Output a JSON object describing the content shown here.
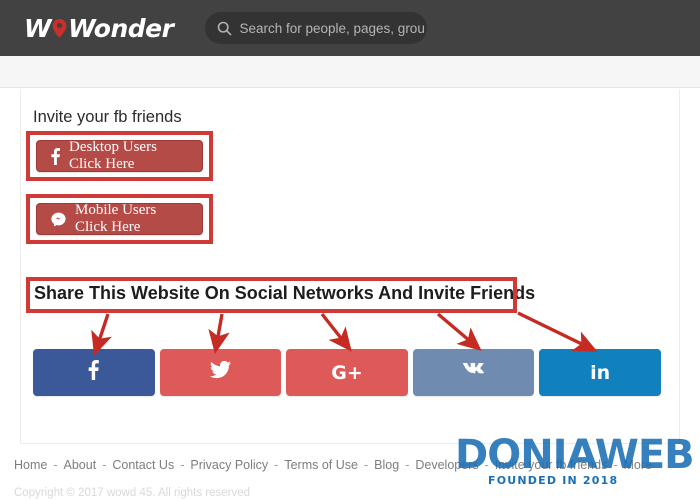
{
  "header": {
    "logo_prefix": "W",
    "logo_pin_icon": "location-pin-icon",
    "logo_suffix": "Wonder",
    "search": {
      "icon": "search-icon",
      "placeholder": "Search for people, pages, groups",
      "value": ""
    }
  },
  "main": {
    "invite_title": "Invite your fb friends",
    "desktop_button": {
      "icon": "facebook-f-icon",
      "label": "Desktop Users Click Here"
    },
    "mobile_button": {
      "icon": "messenger-chat-icon",
      "label": "Mobile Users Click Here"
    },
    "share_title": "Share This Website On Social Networks And Invite Friends",
    "social_buttons": [
      {
        "name": "facebook",
        "icon": "facebook-f-icon",
        "label": "f",
        "color": "#3b5998"
      },
      {
        "name": "twitter",
        "icon": "twitter-bird-icon",
        "label": "",
        "color": "#dd5a58"
      },
      {
        "name": "google-plus",
        "icon": "google-plus-icon",
        "label": "G+",
        "color": "#dd5a58"
      },
      {
        "name": "vk",
        "icon": "vk-icon",
        "label": "VK",
        "color": "#6f8cb0"
      },
      {
        "name": "linkedin",
        "icon": "linkedin-in-icon",
        "label": "in",
        "color": "#1181bd"
      }
    ]
  },
  "annotations": {
    "box_color": "#cf3a36",
    "arrow_color": "#c62b23",
    "boxes": [
      "desktop-button-highlight",
      "mobile-button-highlight",
      "share-title-highlight"
    ],
    "arrow_count": 5
  },
  "footer": {
    "links": [
      "Home",
      "About",
      "Contact Us",
      "Privacy Policy",
      "Terms of Use",
      "Blog",
      "Developers",
      "Invite your fb friends",
      "More"
    ],
    "separator": "-",
    "copyright": "Copyright © 2017 wowd 45. All rights reserved"
  },
  "watermark": {
    "title": "DONIAWEB",
    "subtitle": "FOUNDED IN 2018",
    "color": "#1a6fb4"
  }
}
